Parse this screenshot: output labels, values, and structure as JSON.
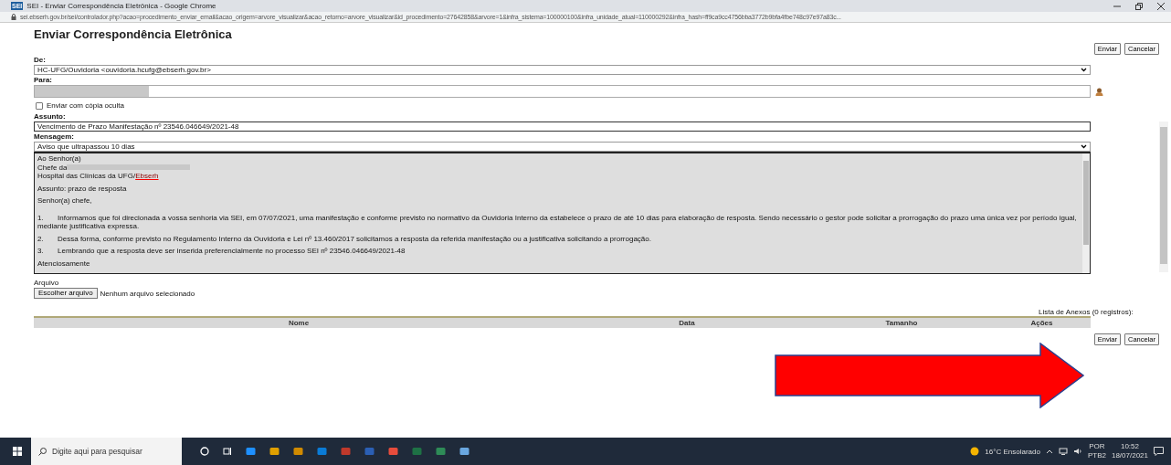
{
  "window": {
    "title": "SEI - Enviar Correspondência Eletrônica - Google Chrome",
    "app_badge": "SEI",
    "url": "sei.ebserh.gov.br/sei/controlador.php?acao=procedimento_enviar_email&acao_origem=arvore_visualizar&acao_retorno=arvore_visualizar&id_procedimento=27642858&arvore=1&infra_sistema=100000100&infra_unidade_atual=110000292&infra_hash=ff9ca9cc4756bba3772b9bfa4fbe748c97e97a83c..."
  },
  "page": {
    "heading": "Enviar Correspondência Eletrônica",
    "top_buttons": [
      "Enviar",
      "Cancelar"
    ],
    "de": {
      "label": "De:",
      "value": "HC-UFG/Ouvidoria <ouvidoria.hcufg@ebserh.gov.br>"
    },
    "para": {
      "label": "Para:"
    },
    "bcc": {
      "label": "Enviar com cópia oculta",
      "checked": false
    },
    "assunto": {
      "label": "Assunto:",
      "value": "Vencimento de Prazo Manifestação nº 23546.046649/2021-48"
    },
    "mensagem": {
      "label": "Mensagem:",
      "value": "Aviso que ultrapassou 10 dias"
    },
    "body": {
      "header_lines": [
        {
          "text": "Ao Senhor(a)",
          "redacted": false
        },
        {
          "text": "Chefe da",
          "redacted": true
        },
        {
          "text": "Hospital das Clínicas da UFG/",
          "link": "Ebserh",
          "redacted": false
        }
      ],
      "subject": "Assunto: prazo de resposta",
      "greeting": "Senhor(a) chefe,",
      "items": [
        {
          "number": "1.",
          "text": "Informamos que foi direcionada a vossa senhoria via SEI, em 07/07/2021, uma manifestação e conforme previsto no normativo da Ouvidoria Interno da estabelece o prazo de até 10 dias para elaboração de resposta. Sendo necessário o gestor pode solicitar a prorrogação do prazo uma única vez por período igual, mediante justificativa expressa."
        },
        {
          "number": "2.",
          "text": "Dessa forma, conforme previsto no Regulamento Interno da Ouvidoria e Lei nº 13.460/2017 solicitamos a resposta da referida manifestação ou a justificativa solicitando a prorrogação."
        },
        {
          "number": "3.",
          "text": "Lembrando que a resposta deve ser inserida preferencialmente no processo SEI nº 23546.046649/2021-48"
        }
      ],
      "closing": "Atenciosamente"
    },
    "arquivo": {
      "label": "Arquivo",
      "button": "Escolher arquivo",
      "status": "Nenhum arquivo selecionado"
    },
    "attachments": {
      "caption": "Lista de Anexos (0 registros):",
      "columns": [
        "Nome",
        "Data",
        "Tamanho",
        "Ações"
      ]
    },
    "bottom_buttons": [
      "Enviar",
      "Cancelar"
    ]
  },
  "taskbar": {
    "search_placeholder": "Digite aqui para pesquisar",
    "weather": "16°C Ensolarado",
    "language": "POR",
    "layout": "PTB2",
    "time": "10:52",
    "date": "18/07/2021"
  }
}
